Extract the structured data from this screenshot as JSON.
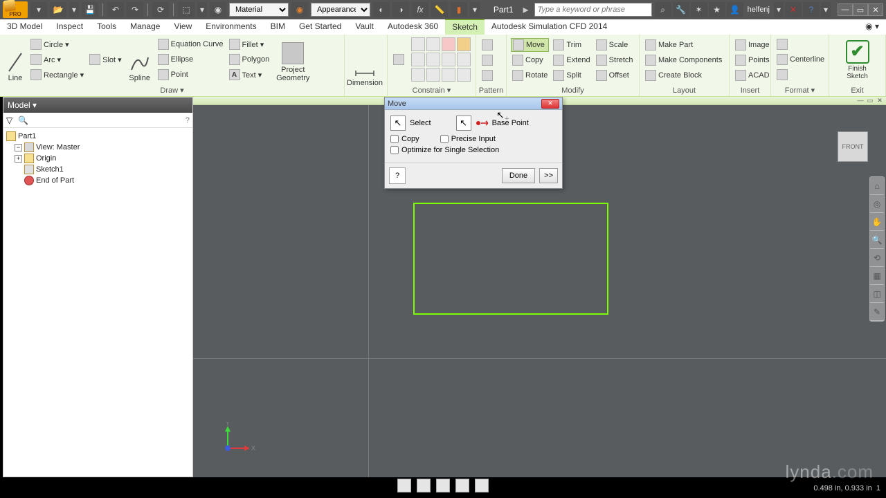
{
  "titlebar": {
    "logo_label": "PRO",
    "material": "Material",
    "appearance": "Appearance",
    "partname": "Part1",
    "search_placeholder": "Type a keyword or phrase",
    "username": "helfenj"
  },
  "tabs": {
    "items": [
      "3D Model",
      "Inspect",
      "Tools",
      "Manage",
      "View",
      "Environments",
      "BIM",
      "Get Started",
      "Vault",
      "Autodesk 360",
      "Sketch",
      "Autodesk Simulation CFD 2014"
    ],
    "active_index": 10
  },
  "ribbon": {
    "draw": {
      "title": "Draw ▾",
      "line": "Line",
      "circle": "Circle ▾",
      "arc": "Arc ▾",
      "rectangle": "Rectangle ▾",
      "slot": "Slot ▾",
      "ellipse": "Ellipse",
      "point": "Point",
      "spline": "Spline",
      "equation": "Equation Curve",
      "fillet": "Fillet ▾",
      "polygon": "Polygon",
      "text": "Text ▾",
      "project": "Project Geometry"
    },
    "dimension": {
      "title": "",
      "label": "Dimension"
    },
    "constrain": {
      "title": "Constrain ▾"
    },
    "pattern": {
      "title": "Pattern"
    },
    "modify": {
      "title": "Modify",
      "move": "Move",
      "copy": "Copy",
      "rotate": "Rotate",
      "trim": "Trim",
      "extend": "Extend",
      "split": "Split",
      "scale": "Scale",
      "stretch": "Stretch",
      "offset": "Offset"
    },
    "layout": {
      "title": "Layout",
      "make_part": "Make Part",
      "make_components": "Make Components",
      "create_block": "Create Block"
    },
    "insert": {
      "title": "Insert",
      "image": "Image",
      "points": "Points",
      "acad": "ACAD"
    },
    "format": {
      "title": "Format ▾",
      "centerline": "Centerline"
    },
    "exit": {
      "title": "Exit",
      "finish": "Finish Sketch"
    }
  },
  "browser": {
    "header": "Model ▾",
    "items": {
      "part": "Part1",
      "view": "View: Master",
      "origin": "Origin",
      "sketch": "Sketch1",
      "end": "End of Part"
    }
  },
  "dialog": {
    "title": "Move",
    "select": "Select",
    "base_point": "Base Point",
    "copy": "Copy",
    "precise": "Precise Input",
    "optimize": "Optimize for Single Selection",
    "done": "Done",
    "expand": ">>"
  },
  "viewcube": "FRONT",
  "axes": {
    "x": "X",
    "y": "Y"
  },
  "status": "0.498 in, 0.933 in",
  "watermark": {
    "brand": "lynda",
    "suffix": ".com"
  }
}
